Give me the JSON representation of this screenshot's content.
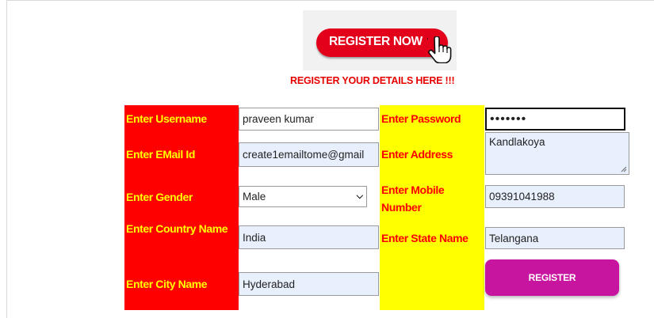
{
  "banner": {
    "text": "REGISTER NOW"
  },
  "heading": "REGISTER YOUR DETAILS HERE !!!",
  "labels": {
    "username": "Enter Username",
    "email": "Enter EMail Id",
    "gender": "Enter Gender",
    "country": "Enter Country Name",
    "city": "Enter City Name",
    "password": "Enter Password",
    "address": "Enter Address",
    "mobile": "Enter Mobile Number",
    "state": "Enter State Name"
  },
  "values": {
    "username": "praveen kumar",
    "email": "create1emailtome@gmail",
    "gender": "Male",
    "country": "India",
    "city": "Hyderabad",
    "password": "•••••••",
    "address": "Kandlakoya",
    "mobile": "09391041988",
    "state": "Telangana"
  },
  "submit": {
    "label": "REGISTER"
  },
  "colors": {
    "label_col_left": "#ff0000",
    "label_col_right": "#ffff00",
    "button": "#c7159f"
  }
}
